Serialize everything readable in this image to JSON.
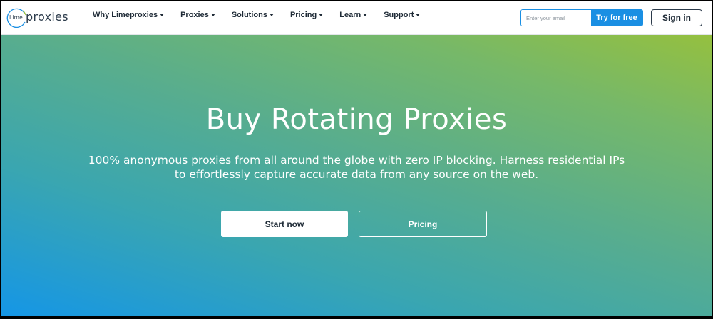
{
  "brand": {
    "logo_small": "Lime",
    "logo_word": "proxies",
    "colors": {
      "accent_blue": "#1a8fe3",
      "gradient_start": "#1596e6",
      "gradient_end": "#95c03f"
    }
  },
  "nav": {
    "items": [
      {
        "label": "Why Limeproxies"
      },
      {
        "label": "Proxies"
      },
      {
        "label": "Solutions"
      },
      {
        "label": "Pricing"
      },
      {
        "label": "Learn"
      },
      {
        "label": "Support"
      }
    ],
    "dropdown_icon": "caret-down-icon"
  },
  "signup": {
    "email_placeholder": "Enter your email",
    "email_value": "",
    "try_label": "Try for free"
  },
  "signin": {
    "label": "Sign in"
  },
  "hero": {
    "title": "Buy Rotating Proxies",
    "subtitle": "100% anonymous proxies from all around the globe with zero IP blocking. Harness residential IPs to effortlessly capture accurate data from any source on the web.",
    "start_label": "Start now",
    "pricing_label": "Pricing"
  }
}
